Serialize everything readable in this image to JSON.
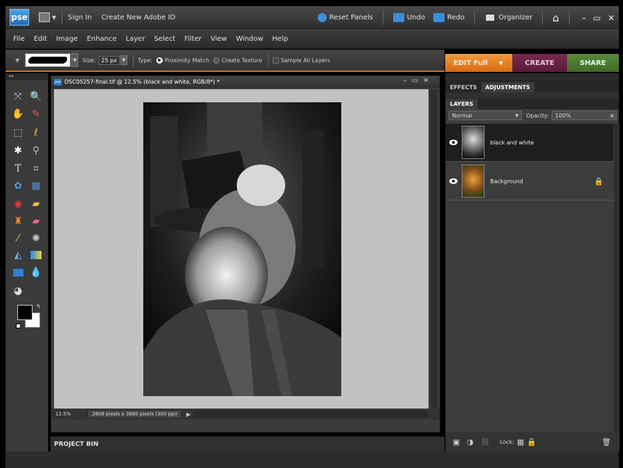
{
  "titlebar": {
    "logo": "pse",
    "sign_in": "Sign In",
    "create_id": "Create New Adobe ID",
    "reset_panels": "Reset Panels",
    "undo": "Undo",
    "redo": "Redo",
    "organizer": "Organizer",
    "controls": [
      "–",
      "▭",
      "✕"
    ]
  },
  "menu": [
    "File",
    "Edit",
    "Image",
    "Enhance",
    "Layer",
    "Select",
    "Filter",
    "View",
    "Window",
    "Help"
  ],
  "options": {
    "size_label": "Size:",
    "size_value": "25 px",
    "type_label": "Type:",
    "proximity": "Proximity Match",
    "texture": "Create Texture",
    "sample_all": "Sample All Layers"
  },
  "modes": {
    "edit": "EDIT Full",
    "create": "CREATE",
    "share": "SHARE"
  },
  "document": {
    "title": "DSC05257-final.tif @ 12.5% (black and white, RGB/8*) *",
    "zoom": "12.5%",
    "dimensions": "2608 pixels x 3880 pixels (300 ppi)"
  },
  "project_bin": {
    "label": "PROJECT BIN"
  },
  "panel": {
    "tabs": [
      "EFFECTS",
      "ADJUSTMENTS"
    ],
    "layers_tab": "LAYERS",
    "blend_mode": "Normal",
    "opacity_label": "Opacity:",
    "opacity_value": "100%",
    "lock_label": "Lock:",
    "layers": [
      {
        "name": "black and white",
        "selected": true,
        "locked": false
      },
      {
        "name": "Background",
        "selected": false,
        "locked": true
      }
    ]
  },
  "colors": {
    "accent_orange": "#e36c1b",
    "create_tab": "#6a2244",
    "share_tab": "#4d7a30",
    "canvas_bg": "#c2c2c2"
  }
}
